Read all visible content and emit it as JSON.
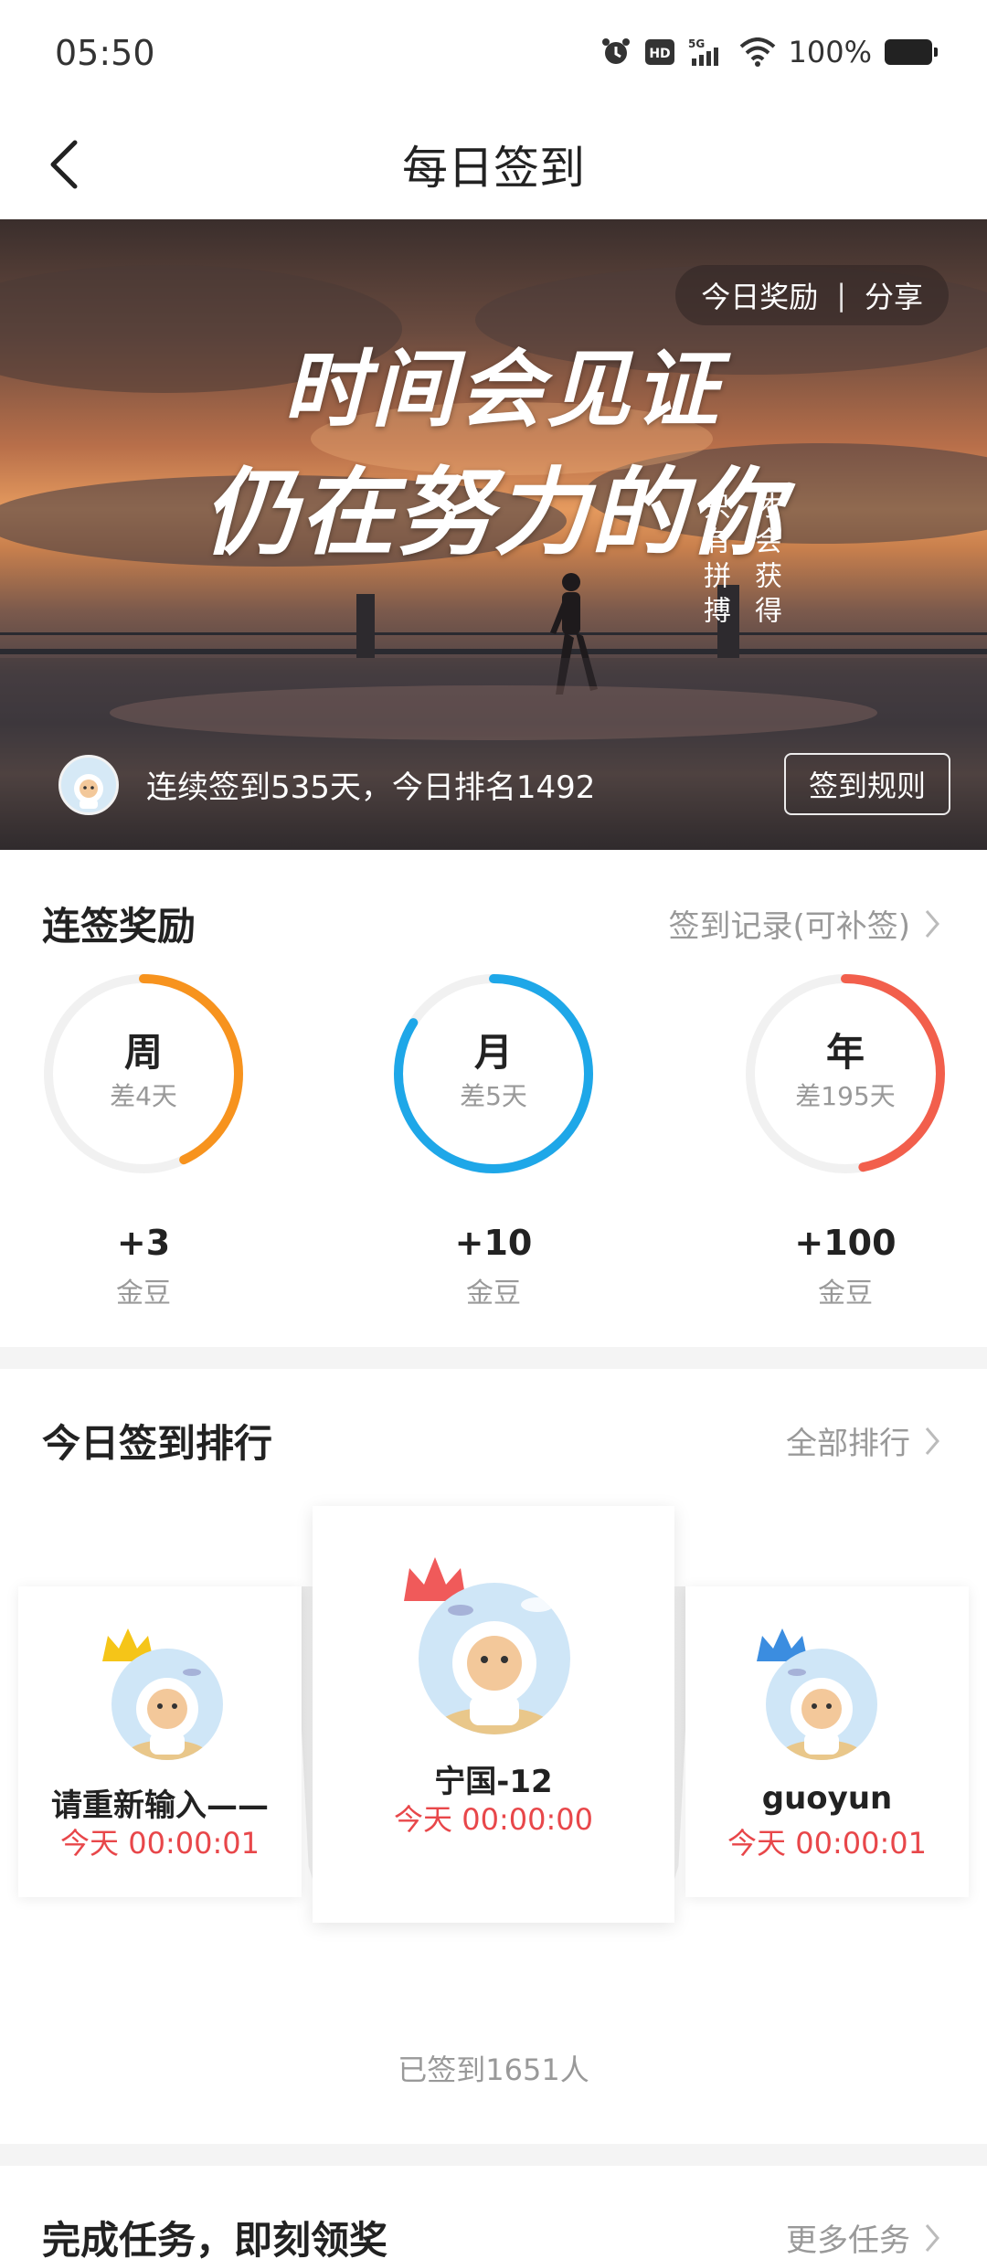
{
  "status_bar": {
    "time": "05:50",
    "battery": "100%"
  },
  "nav": {
    "title": "每日签到"
  },
  "banner": {
    "pill_reward": "今日奖励",
    "pill_sep": "|",
    "pill_share": "分享",
    "headline_line1": "时间会见证",
    "headline_line2": "仍在努力的你",
    "poem_col1": "只有拼搏",
    "poem_col2": "才会获得",
    "streak_text": "连续签到535天，今日排名1492",
    "rule_button": "签到规则"
  },
  "streak_rewards": {
    "title": "连签奖励",
    "link": "签到记录(可补签)",
    "items": [
      {
        "label": "周",
        "remaining": "差4天",
        "amount": "+3",
        "unit": "金豆",
        "progress": 0.43,
        "color": "#f7931e"
      },
      {
        "label": "月",
        "remaining": "差5天",
        "amount": "+10",
        "unit": "金豆",
        "progress": 0.84,
        "color": "#1ea7e8"
      },
      {
        "label": "年",
        "remaining": "差195天",
        "amount": "+100",
        "unit": "金豆",
        "progress": 0.47,
        "color": "#f25f4c"
      }
    ]
  },
  "ranking": {
    "title": "今日签到排行",
    "link": "全部排行",
    "first": {
      "name": "宁国-12",
      "time": "今天 00:00:00"
    },
    "second": {
      "name": "请重新输入——",
      "time": "今天 00:00:01"
    },
    "third": {
      "name": "guoyun",
      "time": "今天 00:00:01"
    },
    "signed_count": "已签到1651人"
  },
  "tasks": {
    "title": "完成任务，即刻领奖",
    "link": "更多任务"
  },
  "colors": {
    "accent_red": "#e8474a",
    "crown_gold": "#f5c518",
    "crown_red": "#f05a5a",
    "crown_blue": "#3b8de0"
  }
}
